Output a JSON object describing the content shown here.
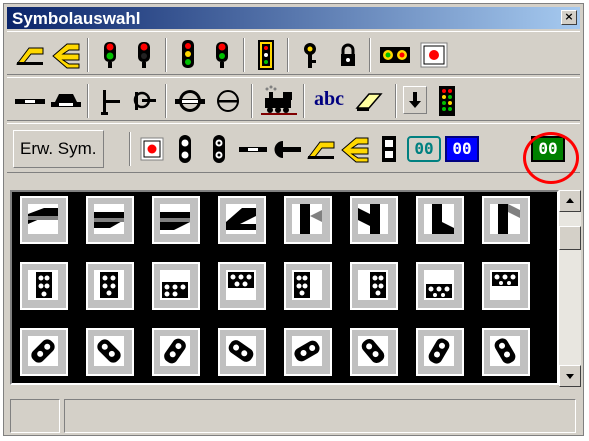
{
  "window": {
    "title": "Symbolauswahl",
    "close_glyph": "×"
  },
  "toolbar_row1": [
    {
      "name": "track-diagonal-up-icon",
      "kind": "track-yellow"
    },
    {
      "name": "track-diagonal-arrow-icon",
      "kind": "track-yellow-arrow"
    },
    {
      "name": "signal-red-green-icon",
      "kind": "signal2"
    },
    {
      "name": "signal-red-black-icon",
      "kind": "signal2b"
    },
    {
      "name": "signal-three-light-icon",
      "kind": "signal3"
    },
    {
      "name": "signal-dual-head-icon",
      "kind": "signal2c"
    },
    {
      "name": "signal-yellow-box-icon",
      "kind": "signalbox"
    },
    {
      "name": "key-icon",
      "kind": "key"
    },
    {
      "name": "lock-icon",
      "kind": "lock"
    },
    {
      "name": "bulb-double-icon",
      "kind": "bulbs"
    },
    {
      "name": "red-dot-button-icon",
      "kind": "reddot"
    }
  ],
  "toolbar_row2": [
    {
      "name": "track-straight-icon",
      "kind": "straight"
    },
    {
      "name": "track-buffer-icon",
      "kind": "buffer"
    },
    {
      "name": "signal-mast-icon",
      "kind": "mast"
    },
    {
      "name": "signal-disc-icon",
      "kind": "disc"
    },
    {
      "name": "turntable-icon",
      "kind": "turntable"
    },
    {
      "name": "circle-minus-icon",
      "kind": "circleminus"
    },
    {
      "name": "locomotive-icon",
      "kind": "loco"
    },
    {
      "name": "eraser-icon",
      "kind": "eraser"
    },
    {
      "name": "arrow-down-icon",
      "kind": "arrowdown"
    },
    {
      "name": "signal-panel-icon",
      "kind": "panel"
    }
  ],
  "toolbar_row2_text": {
    "abc_label": "abc"
  },
  "toolbar_row3": {
    "extended_symbols_label": "Erw. Sym.",
    "counter_labels": [
      "00",
      "00",
      "00"
    ],
    "colors": {
      "counter_teal": "#008080",
      "counter_blue": "#0000ff",
      "counter_green": "#008000",
      "highlight_ring": "#ff0000"
    }
  },
  "symbol_grid": {
    "rows": 3,
    "cols": 8
  },
  "status_bar": {
    "panel1": "",
    "panel2": ""
  }
}
